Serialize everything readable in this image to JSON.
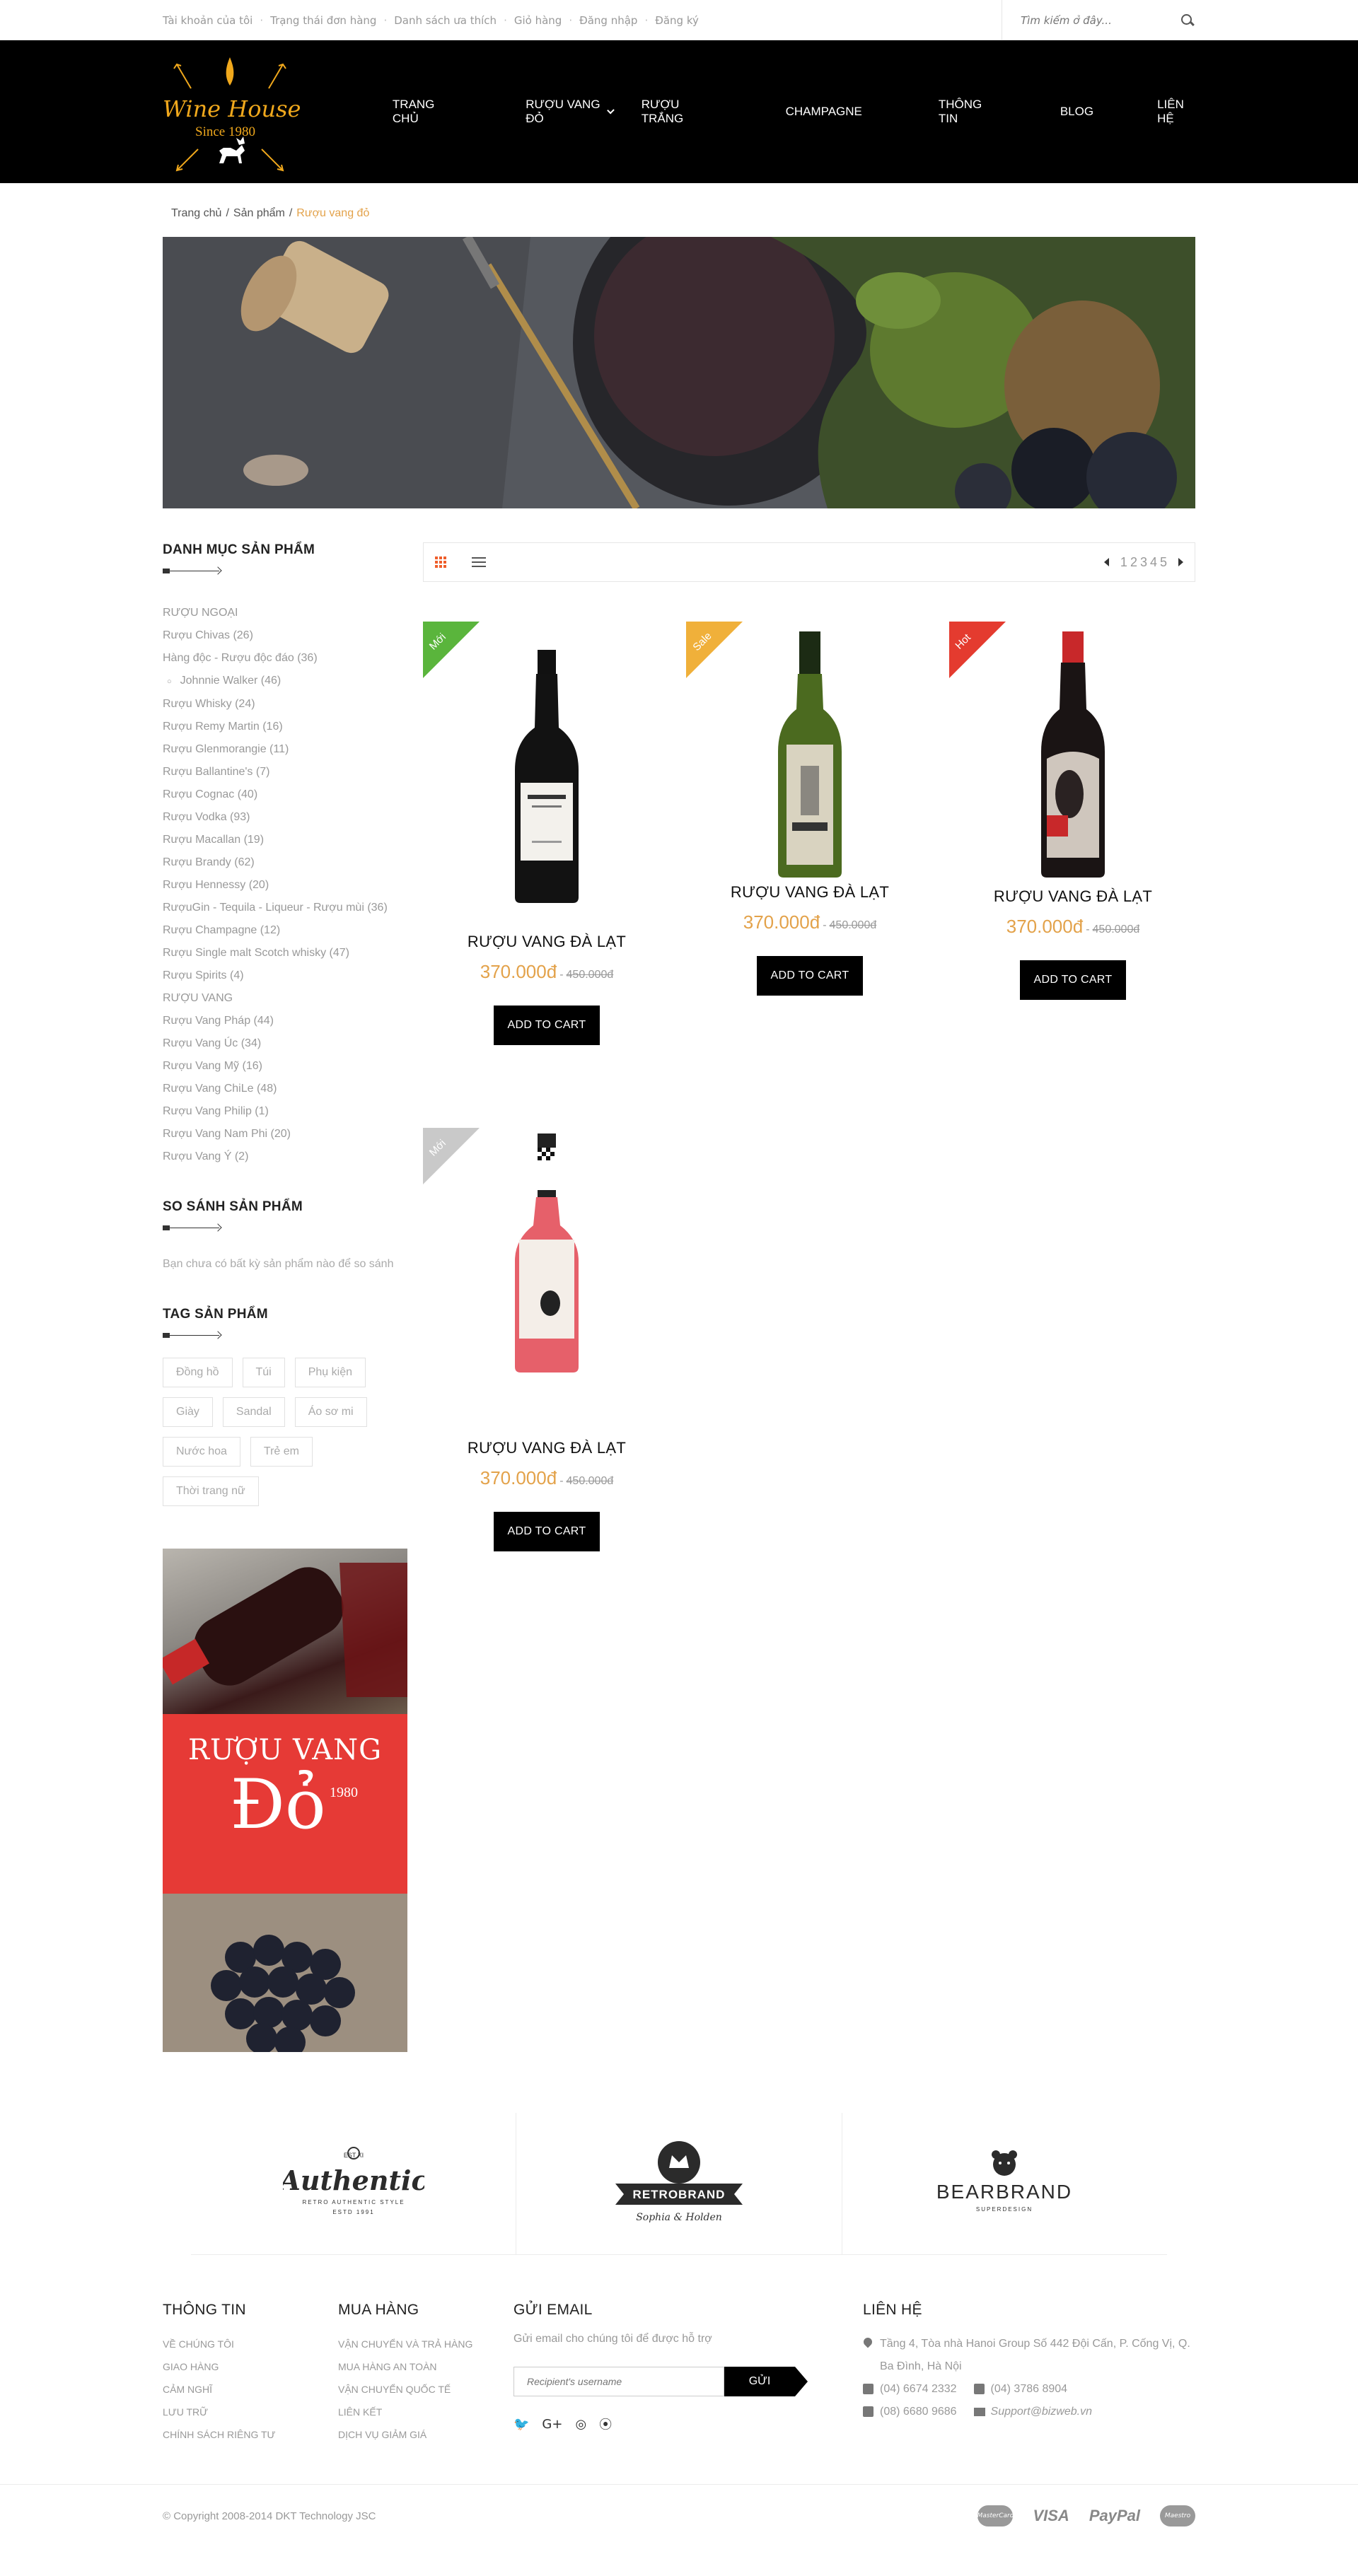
{
  "topbar": {
    "links": [
      "Tài khoản của tôi",
      "Trạng thái đơn hàng",
      "Danh sách ưa thích",
      "Giỏ hàng",
      "Đăng nhập",
      "Đăng ký"
    ],
    "search_placeholder": "Tìm kiếm ở đây..."
  },
  "logo": {
    "title": "Wine House",
    "since": "Since 1980"
  },
  "nav": [
    "TRANG CHỦ",
    "RƯỢU VANG ĐỎ",
    "RƯỢU TRẮNG",
    "CHAMPAGNE",
    "THÔNG TIN",
    "BLOG",
    "LIÊN HỆ"
  ],
  "breadcrumb": {
    "home": "Trang chủ",
    "products": "Sản phẩm",
    "current": "Rượu vang đỏ"
  },
  "sidebar": {
    "categories_title": "DANH MỤC SẢN PHẨM",
    "categories": [
      "RƯỢU NGOẠI",
      "Rượu Chivas (26)",
      "Hàng độc - Rượu độc đáo (36)",
      "Johnnie Walker (46)",
      "Rượu Whisky (24)",
      "Rượu Remy Martin (16)",
      "Rượu Glenmorangie (11)",
      "Rượu Ballantine's (7)",
      "Rượu Cognac (40)",
      "Rượu Vodka (93)",
      "Rượu Macallan (19)",
      "Rượu Brandy (62)",
      "Rượu Hennessy (20)",
      "RượuGin - Tequila - Liqueur - Rượu mùi (36)",
      "Rượu Champagne (12)",
      "Rượu Single malt Scotch whisky (47)",
      "Rượu Spirits (4)",
      "RƯỢU VANG",
      "Rượu Vang Pháp (44)",
      "Rượu Vang Úc (34)",
      "Rượu Vang Mỹ (16)",
      "Rượu Vang ChiLe (48)",
      "Rượu Vang Philip (1)",
      "Rượu Vang Nam Phi (20)",
      "Rượu Vang Ý (2)"
    ],
    "compare_title": "SO SÁNH SẢN PHẨM",
    "compare_text": "Bạn chưa có bất kỳ sản phẩm nào để so sánh",
    "tags_title": "TAG SẢN PHẨM",
    "tags": [
      "Đồng hồ",
      "Túi",
      "Phụ kiện",
      "Giày",
      "Sandal",
      "Áo sơ mi",
      "Nước hoa",
      "Trẻ em",
      "Thời trang nữ"
    ],
    "ad": {
      "line1": "RƯỢU VANG",
      "line2": "Đỏ",
      "year": "1980"
    }
  },
  "pager": [
    "1",
    "2",
    "3",
    "4",
    "5"
  ],
  "products": [
    {
      "badge": "Mới",
      "badge_color": "#5ab53c",
      "name": "RƯỢU VANG ĐÀ LẠT",
      "price": "370.000đ",
      "old_price": "450.000đ",
      "button": "ADD TO CART",
      "bottle": "dark"
    },
    {
      "badge": "Sale",
      "badge_color": "#f0b03a",
      "name": "RƯỢU VANG ĐÀ LẠT",
      "price": "370.000đ",
      "old_price": "450.000đ",
      "button": "ADD TO CART",
      "bottle": "green"
    },
    {
      "badge": "Hot",
      "badge_color": "#e43b2f",
      "name": "RƯỢU VANG ĐÀ LẠT",
      "price": "370.000đ",
      "old_price": "450.000đ",
      "button": "ADD TO CART",
      "bottle": "face"
    },
    {
      "badge": "Mới",
      "badge_color": "#c9c9c9",
      "name": "RƯỢU VANG ĐÀ LẠT",
      "price": "370.000đ",
      "old_price": "450.000đ",
      "button": "ADD TO CART",
      "bottle": "rose"
    }
  ],
  "brands": [
    {
      "name": "Authentic",
      "sub": "RETRO AUTHENTIC STYLE",
      "est": "ESTD 1991",
      "mark": "EST XI"
    },
    {
      "name": "RETROBRAND",
      "sub": "Sophia & Holden"
    },
    {
      "name": "BEARBRAND",
      "sub": "SUPERDESIGN"
    }
  ],
  "footer": {
    "info_title": "THÔNG TIN",
    "info_links": [
      "VỀ CHÚNG TÔI",
      "GIAO HÀNG",
      "CẢM NGHĨ",
      "LƯU TRỮ",
      "CHÍNH SÁCH RIÊNG TƯ"
    ],
    "shop_title": "MUA HÀNG",
    "shop_links": [
      "VẬN CHUYỂN VÀ TRẢ HÀNG",
      "MUA HÀNG AN TOÀN",
      "VẬN CHUYỂN QUỐC TẾ",
      "LIÊN KẾT",
      "DỊCH VỤ GIẢM GIÁ"
    ],
    "email_title": "GỬI EMAIL",
    "email_text": "Gửi email cho chúng tôi để được hỗ trợ",
    "email_placeholder": "Recipient's username",
    "email_button": "GỬI",
    "contact_title": "LIÊN HỆ",
    "address": "Tầng 4, Tòa nhà Hanoi Group Số 442 Đội Cấn, P. Cống Vị, Q. Ba Đình, Hà Nội",
    "phone1": "(04) 6674 2332",
    "phone2": "(04) 3786 8904",
    "phone3": "(08) 6680 9686",
    "email": "Support@bizweb.vn"
  },
  "copyright": "© Copyright 2008-2014 DKT Technology JSC",
  "payments": [
    "MasterCard",
    "VISA",
    "PayPal",
    "Maestro"
  ]
}
